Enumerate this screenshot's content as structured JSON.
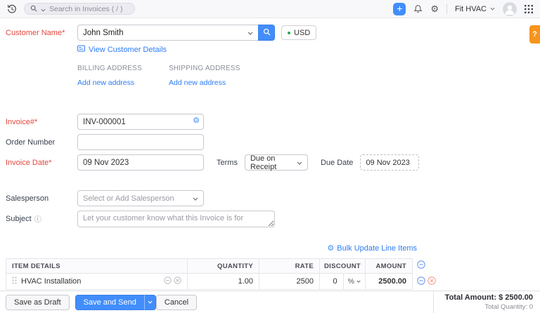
{
  "topbar": {
    "search_placeholder": "Search in Invoices ( / )",
    "org_name": "Fit HVAC"
  },
  "icons": {
    "plus": "+",
    "gear": "⚙",
    "info": "ⓘ",
    "question": "?"
  },
  "customer": {
    "label": "Customer Name*",
    "value": "John Smith",
    "currency": "USD",
    "view_details_label": "View Customer Details",
    "billing_heading": "BILLING ADDRESS",
    "shipping_heading": "SHIPPING ADDRESS",
    "billing_add_link": "Add new address",
    "shipping_add_link": "Add new address"
  },
  "invoice": {
    "number_label": "Invoice#*",
    "number_value": "INV-000001",
    "order_label": "Order Number",
    "order_value": "",
    "date_label": "Invoice Date*",
    "date_value": "09 Nov 2023",
    "terms_label": "Terms",
    "terms_value": "Due on Receipt",
    "due_date_label": "Due Date",
    "due_date_value": "09 Nov 2023",
    "salesperson_label": "Salesperson",
    "salesperson_placeholder": "Select or Add Salesperson",
    "subject_label": "Subject",
    "subject_placeholder": "Let your customer know what this Invoice is for"
  },
  "items": {
    "bulk_update_label": "Bulk Update Line Items",
    "columns": [
      "ITEM DETAILS",
      "QUANTITY",
      "RATE",
      "DISCOUNT",
      "AMOUNT"
    ],
    "rows": [
      {
        "item": "HVAC Installation",
        "quantity": "1.00",
        "rate": "2500",
        "discount": "0",
        "discount_unit": "%",
        "amount": "2500.00"
      }
    ]
  },
  "footer": {
    "save_draft_label": "Save as Draft",
    "save_send_label": "Save and Send",
    "cancel_label": "Cancel",
    "total_amount_label": "Total Amount:",
    "total_amount_value": "$ 2500.00",
    "total_quantity_label": "Total Quantity:",
    "total_quantity_value": "0"
  },
  "colors": {
    "accent_blue": "#408dfb",
    "link_blue": "#2e7cf6",
    "required_red": "#e2483d",
    "help_orange": "#f7941e",
    "currency_green": "#27a95a"
  }
}
